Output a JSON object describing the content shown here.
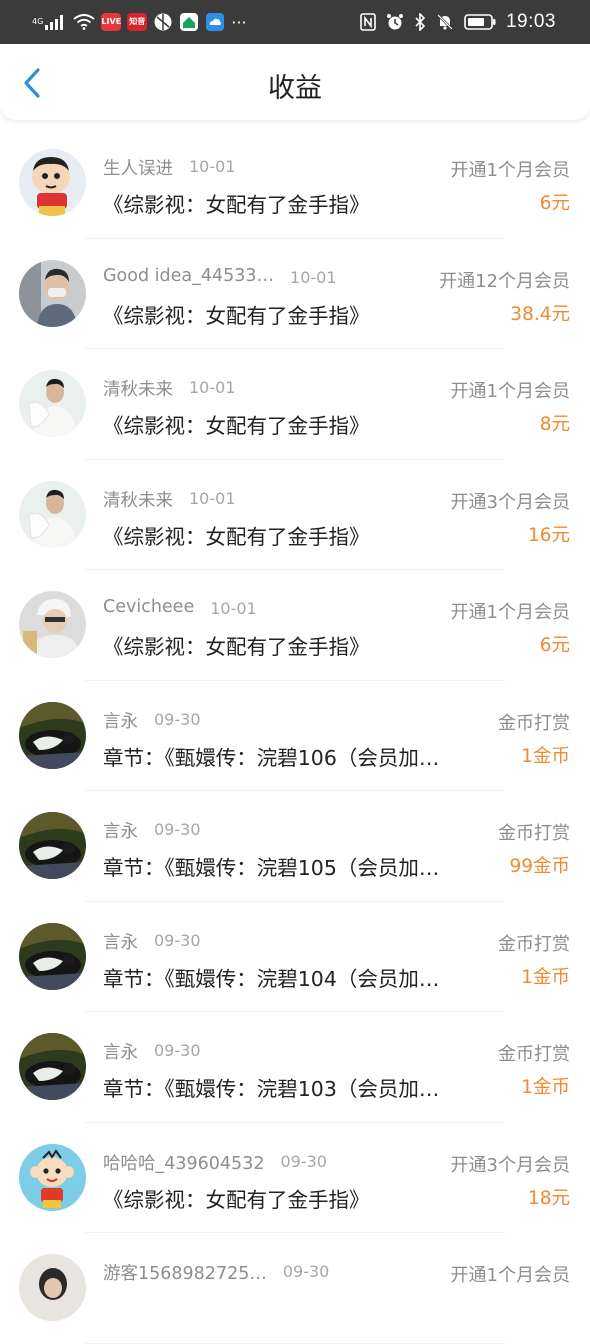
{
  "status_bar": {
    "network_label": "4G",
    "time": "19:03",
    "app_badge_1": "LIVE",
    "app_badge_2": "知音"
  },
  "header": {
    "title": "收益"
  },
  "colors": {
    "accent": "#2d8ee0",
    "amount": "#f08a2f"
  },
  "records": [
    {
      "name": "生人误进",
      "date": "10-01",
      "work": "《综影视：女配有了金手指》",
      "type": "开通1个月会员",
      "amount": "6元",
      "avatar": "cartoon-boy"
    },
    {
      "name": "Good idea_44533…",
      "date": "10-01",
      "work": "《综影视：女配有了金手指》",
      "type": "开通12个月会员",
      "amount": "38.4元",
      "avatar": "man-mask"
    },
    {
      "name": "清秋未来",
      "date": "10-01",
      "work": "《综影视：女配有了金手指》",
      "type": "开通1个月会员",
      "amount": "8元",
      "avatar": "man-white"
    },
    {
      "name": "清秋未来",
      "date": "10-01",
      "work": "《综影视：女配有了金手指》",
      "type": "开通3个月会员",
      "amount": "16元",
      "avatar": "man-white"
    },
    {
      "name": "Cevicheee",
      "date": "10-01",
      "work": "《综影视：女配有了金手指》",
      "type": "开通1个月会员",
      "amount": "6元",
      "avatar": "cap-person"
    },
    {
      "name": "言永",
      "date": "09-30",
      "work": "章节：《甄嬛传：浣碧106（会员加…",
      "type": "金币打赏",
      "amount": "1金币",
      "avatar": "cat"
    },
    {
      "name": "言永",
      "date": "09-30",
      "work": "章节：《甄嬛传：浣碧105（会员加…",
      "type": "金币打赏",
      "amount": "99金币",
      "avatar": "cat"
    },
    {
      "name": "言永",
      "date": "09-30",
      "work": "章节：《甄嬛传：浣碧104（会员加…",
      "type": "金币打赏",
      "amount": "1金币",
      "avatar": "cat"
    },
    {
      "name": "言永",
      "date": "09-30",
      "work": "章节：《甄嬛传：浣碧103（会员加…",
      "type": "金币打赏",
      "amount": "1金币",
      "avatar": "cat"
    },
    {
      "name": "哈哈哈_439604532",
      "date": "09-30",
      "work": "《综影视：女配有了金手指》",
      "type": "开通3个月会员",
      "amount": "18元",
      "avatar": "cartoon-kid"
    },
    {
      "name": "游客1568982725…",
      "date": "09-30",
      "work": "",
      "type": "开通1个月会员",
      "amount": "",
      "avatar": "guest"
    }
  ]
}
